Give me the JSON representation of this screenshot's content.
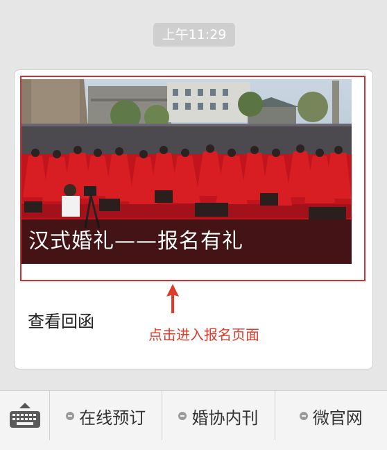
{
  "chat": {
    "timestamp": "上午11:29"
  },
  "card": {
    "caption": "汉式婚礼——报名有礼",
    "action_label": "查看回函",
    "annotation": "点击进入报名页面",
    "highlight_color": "#d03030",
    "annotation_color": "#e03a2a"
  },
  "menu": {
    "keyboard_icon": "keyboard-icon",
    "items": [
      {
        "label": "在线预订",
        "icon": "menu-dot-icon"
      },
      {
        "label": "婚协内刊",
        "icon": "menu-dot-icon"
      },
      {
        "label": "微官网",
        "icon": "menu-dot-icon"
      }
    ]
  }
}
